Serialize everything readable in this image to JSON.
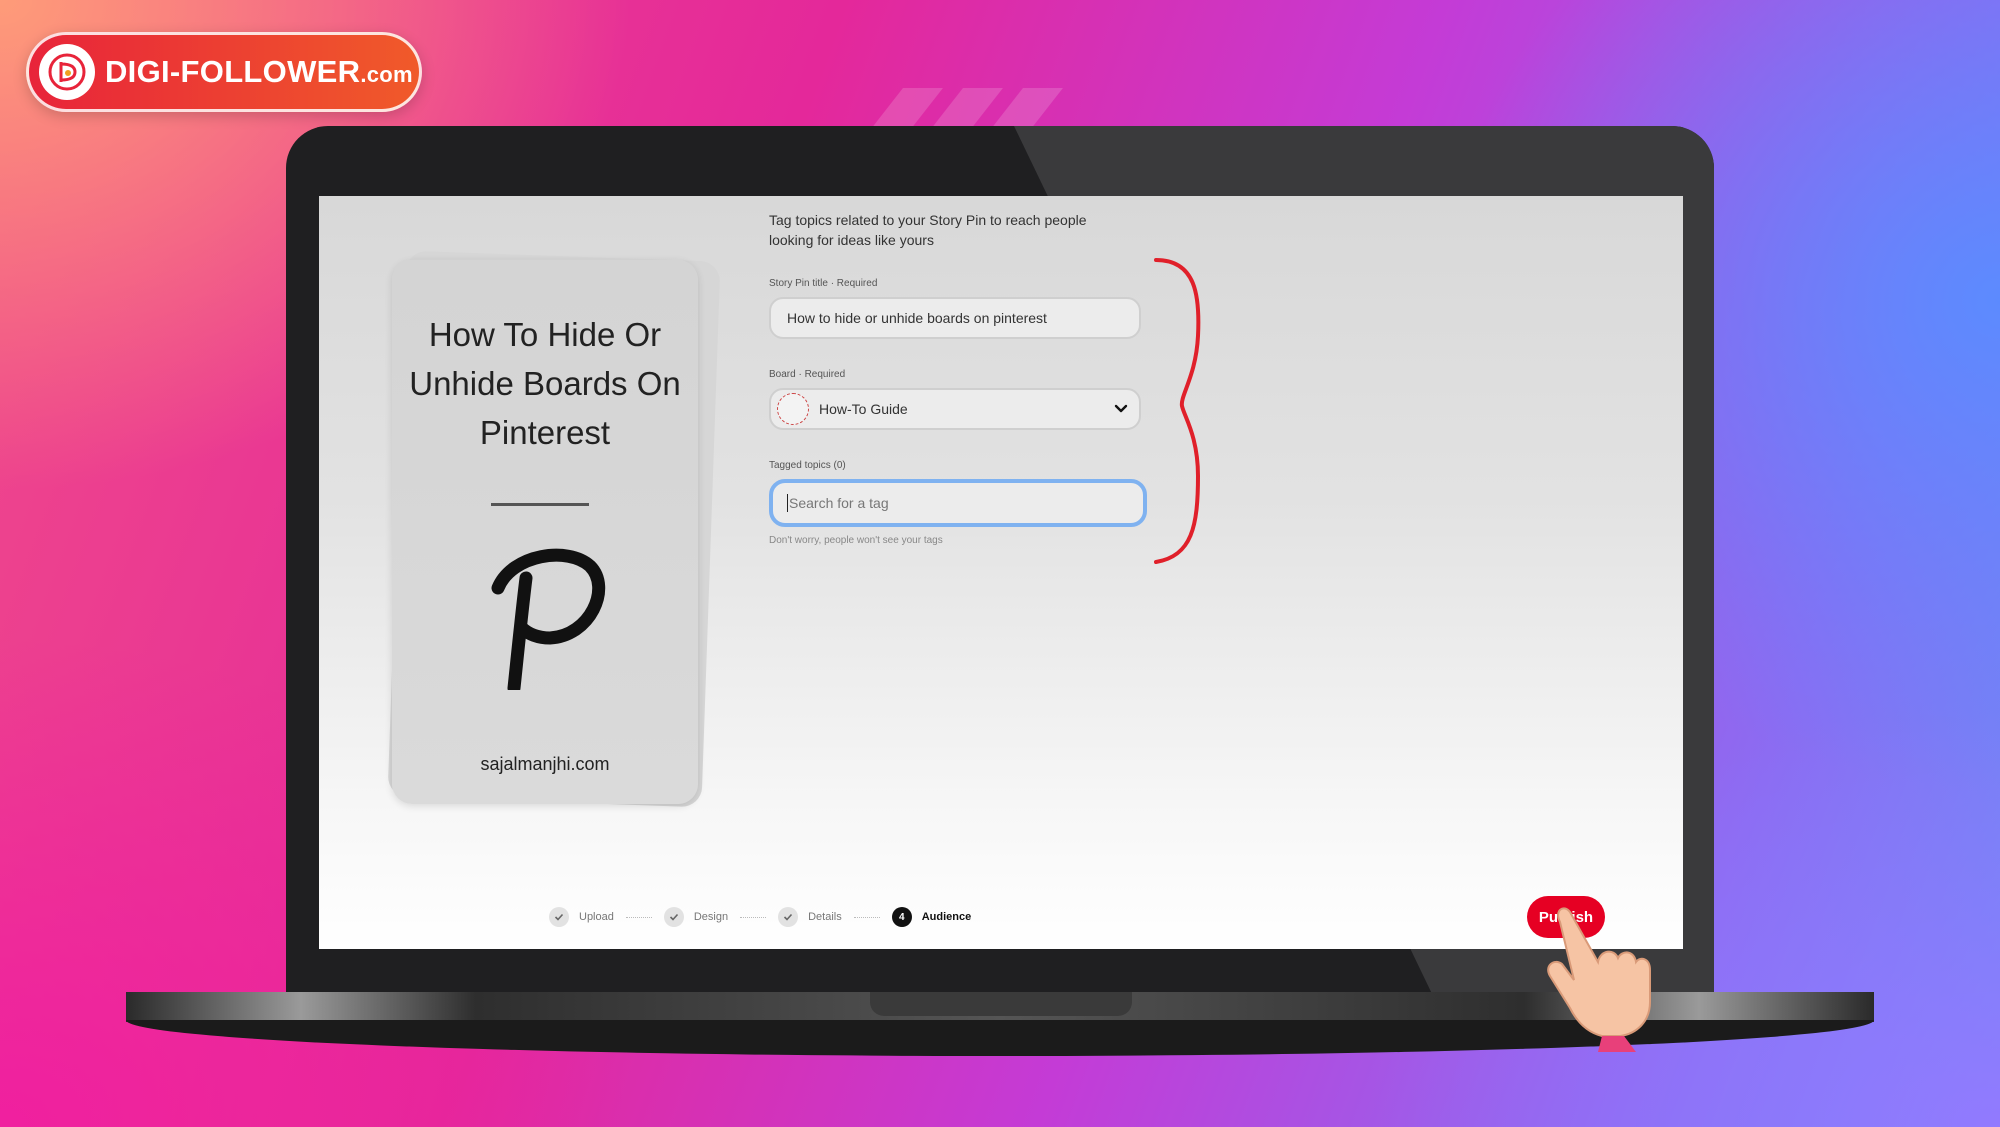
{
  "brand": {
    "name": "DIGI-FOLLOWER",
    "domain": ".com"
  },
  "colors": {
    "accent": "#e60023",
    "focus_ring": "#7fb2f0",
    "annotation": "#e0202a"
  },
  "preview": {
    "title": "How To Hide Or Unhide Boards On Pinterest",
    "url": "sajalmanjhi.com",
    "icon": "pinterest-p-icon"
  },
  "form": {
    "intro": "Tag topics related to your Story Pin to reach people looking for ideas like yours",
    "title_label": "Story Pin title · Required",
    "title_value": "How to hide or unhide boards on pinterest",
    "board_label": "Board · Required",
    "board_value": "How-To Guide",
    "tags_label": "Tagged topics (0)",
    "tags_placeholder": "Search for a tag",
    "tags_hint": "Don't worry, people won't see your tags"
  },
  "steps": [
    {
      "label": "Upload",
      "state": "done"
    },
    {
      "label": "Design",
      "state": "done"
    },
    {
      "label": "Details",
      "state": "done"
    },
    {
      "label": "Audience",
      "state": "current",
      "number": "4"
    }
  ],
  "publish_label": "Publish"
}
